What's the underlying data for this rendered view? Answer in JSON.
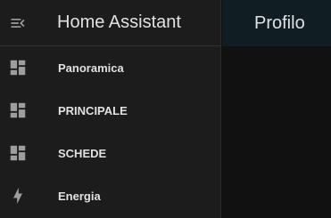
{
  "sidebar": {
    "title": "Home Assistant",
    "toggle_icon": "menu-open-icon",
    "items": [
      {
        "label": "Panoramica",
        "icon": "view-dashboard-icon"
      },
      {
        "label": "PRINCIPALE",
        "icon": "view-dashboard-icon"
      },
      {
        "label": "SCHEDE",
        "icon": "view-dashboard-icon"
      },
      {
        "label": "Energia",
        "icon": "lightning-bolt-icon"
      }
    ]
  },
  "main": {
    "title": "Profilo"
  },
  "colors": {
    "sidebar_bg": "#1c1c1c",
    "topbar_bg": "#101e24",
    "text": "#e1e1e1",
    "icon": "#9e9e9e"
  }
}
